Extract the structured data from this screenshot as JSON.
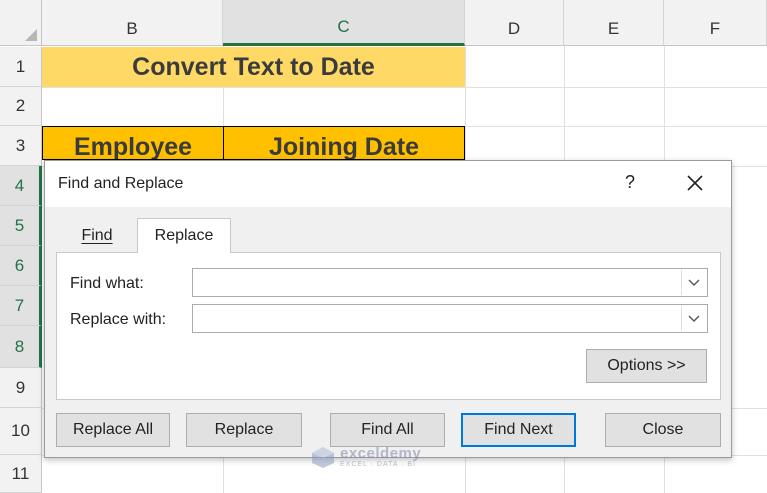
{
  "columns": [
    "B",
    "C",
    "D",
    "E",
    "F"
  ],
  "rows": [
    "1",
    "2",
    "3",
    "4",
    "5",
    "6",
    "7",
    "8",
    "9",
    "10",
    "11"
  ],
  "sheet": {
    "title": "Convert Text to Date",
    "header_employee": "Employee",
    "header_joining_date": "Joining Date"
  },
  "dialog": {
    "title": "Find and Replace",
    "help": "?",
    "tabs": [
      {
        "label": "Find",
        "mnemonic_index": 3
      },
      {
        "label": "Replace",
        "mnemonic_index": 2
      }
    ],
    "find_what_label": "Find what:",
    "replace_with_label": "Replace with:",
    "find_what_value": "",
    "replace_with_value": "",
    "options_button": "Options >>",
    "buttons": {
      "replace_all": "Replace All",
      "replace": "Replace",
      "find_all": "Find All",
      "find_next": "Find Next",
      "close": "Close"
    }
  },
  "watermark": {
    "name": "exceldemy",
    "tagline": "EXCEL · DATA · BI"
  },
  "colors": {
    "title_fill": "#ffd966",
    "header_fill": "#ffc000",
    "selection_accent": "#217346",
    "default_button_border": "#0078d7"
  }
}
